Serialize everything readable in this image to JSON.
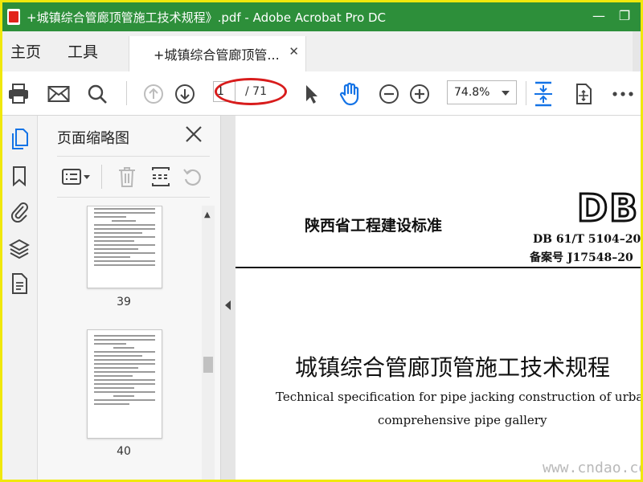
{
  "window": {
    "title": "+城镇综合管廊顶管施工技术规程》.pdf - Adobe Acrobat Pro DC",
    "minimize_glyph": "—",
    "restore_glyph": "❐"
  },
  "menu": {
    "home": "主页",
    "tools": "工具"
  },
  "tab": {
    "label": "+城镇综合管廊顶管...",
    "close": "✕"
  },
  "toolbar": {
    "current_page": "1",
    "total_pages": "/ 71",
    "zoom": "74.8%"
  },
  "panel": {
    "title": "页面缩略图",
    "thumbnails": [
      {
        "label": "39"
      },
      {
        "label": "40"
      }
    ]
  },
  "document": {
    "org": "陕西省工程建设标准",
    "logo": "DB",
    "code": "DB  61/T  5104–20",
    "record": "备案号   J17548–20",
    "title": "城镇综合管廊顶管施工技术规程",
    "en_title_1": "Technical specification for pipe jacking construction of urban",
    "en_title_2": "comprehensive pipe gallery"
  },
  "watermark": "www.cndao.com",
  "colors": {
    "titlebar": "#2d8f3a",
    "accent_blue": "#1473e6",
    "highlight_red": "#d81c1c",
    "frame_yellow": "#f0e80c"
  },
  "icons": [
    "print-icon",
    "email-icon",
    "search-icon",
    "page-up-icon",
    "page-down-icon",
    "select-arrow-icon",
    "hand-icon",
    "zoom-out-icon",
    "zoom-in-icon",
    "fit-page-icon",
    "rotate-view-icon",
    "more-icon",
    "page-thumbnails-icon",
    "bookmark-icon",
    "attachment-icon",
    "layers-icon",
    "content-icon",
    "options-icon",
    "delete-icon",
    "insert-pages-icon",
    "undo-icon"
  ]
}
